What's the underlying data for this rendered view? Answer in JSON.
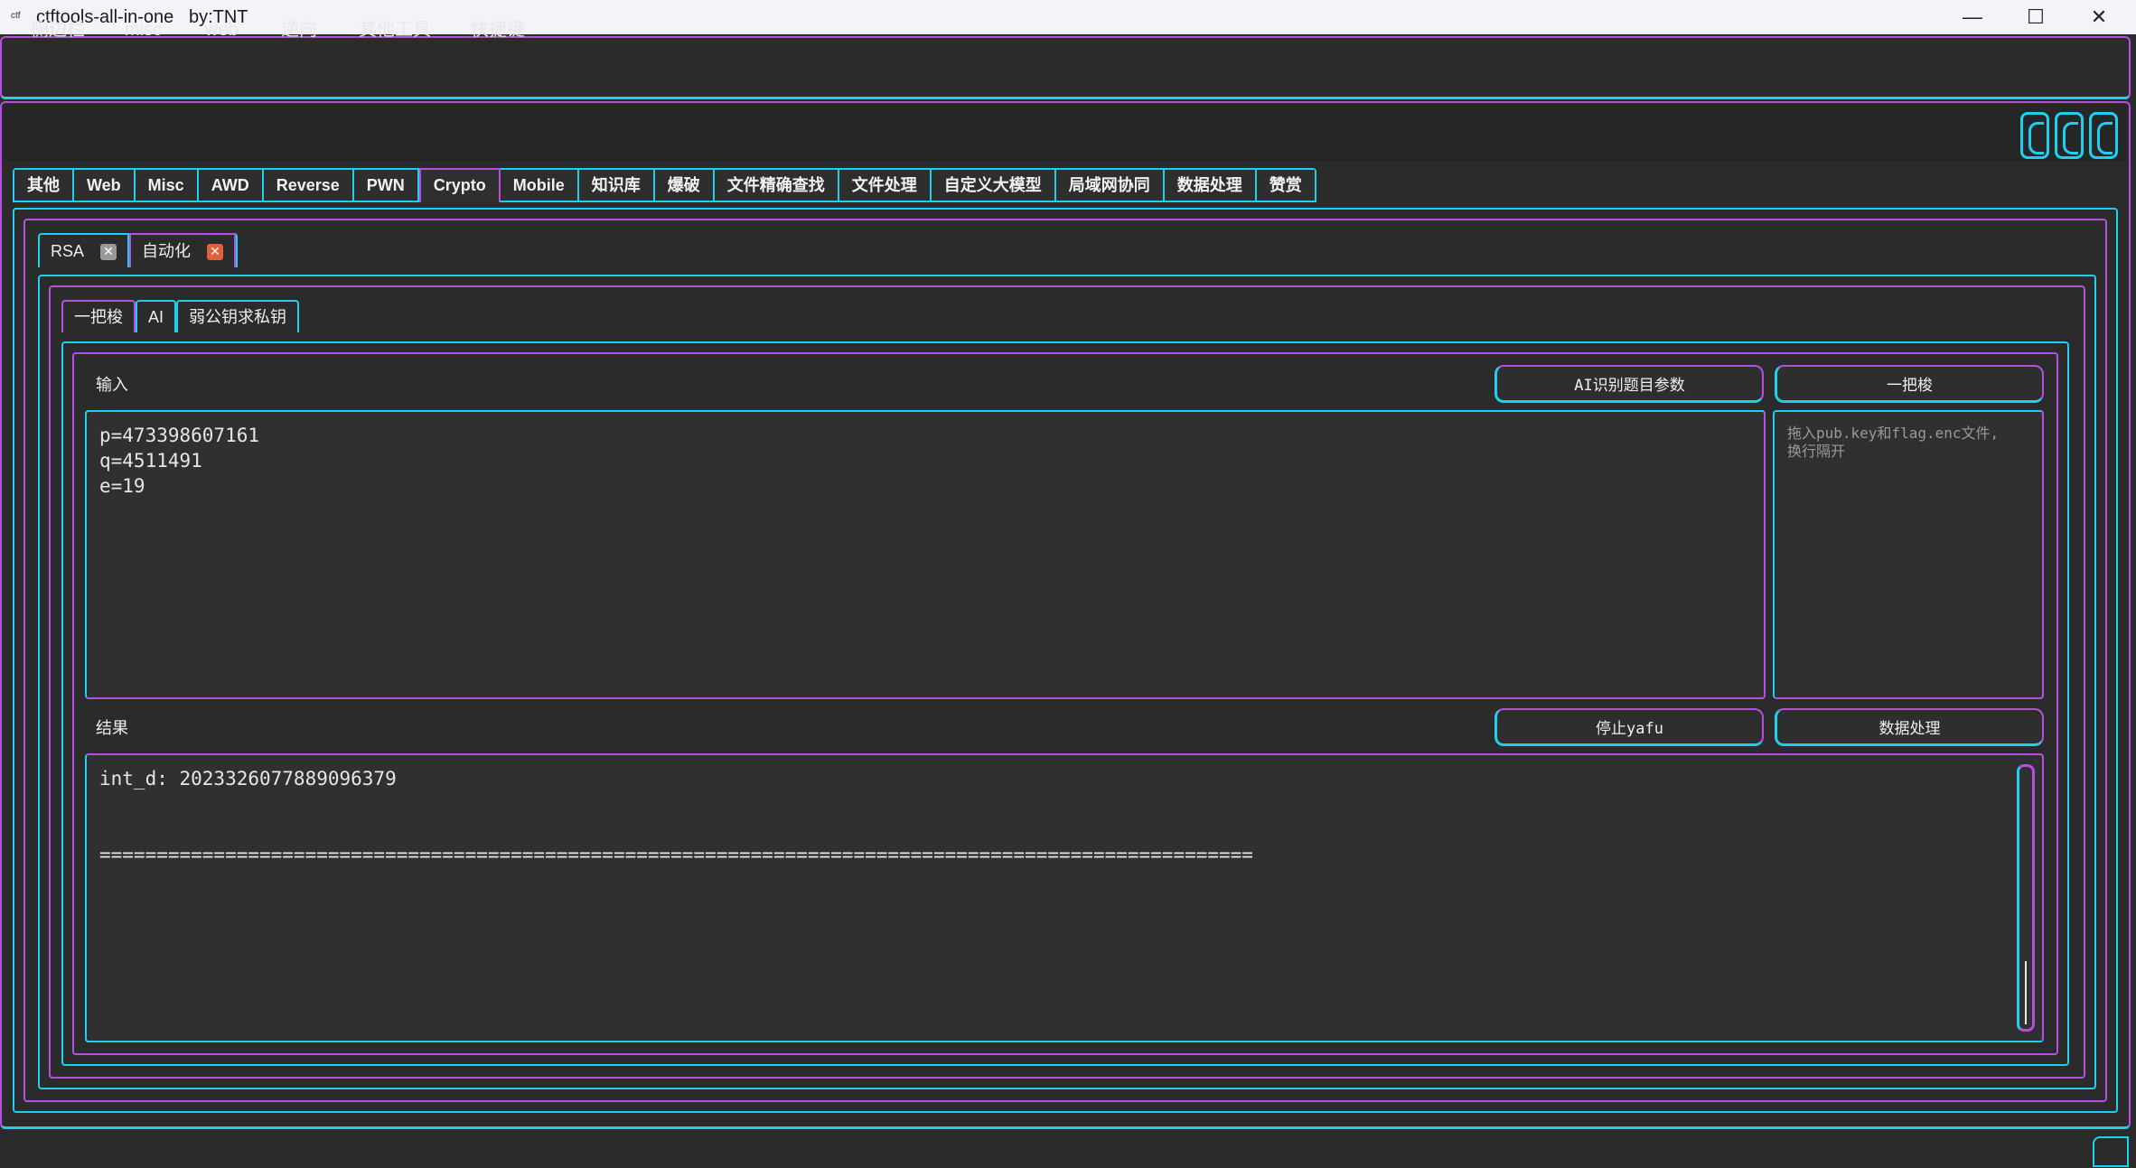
{
  "window": {
    "app_icon_text": "ctf",
    "title": "ctftools-all-in-one   by:TNT",
    "minimize": "—",
    "maximize": "☐",
    "close": "✕"
  },
  "menu": [
    "侧边栏",
    "misc",
    "web",
    "逆向",
    "其他工具",
    "快捷键"
  ],
  "top_tabs": [
    "其他",
    "Web",
    "Misc",
    "AWD",
    "Reverse",
    "PWN",
    "Crypto",
    "Mobile",
    "知识库",
    "爆破",
    "文件精确查找",
    "文件处理",
    "自定义大模型",
    "局域网协同",
    "数据处理",
    "赞赏"
  ],
  "active_top_tab": "Crypto",
  "sub_tabs": [
    {
      "label": "RSA",
      "close": "✕",
      "close_color": "#9a9a9a"
    },
    {
      "label": "自动化",
      "close": "✕",
      "close_color": "#e0603a"
    }
  ],
  "tool_tabs": [
    "一把梭",
    "AI",
    "弱公钥求私钥"
  ],
  "input_section": {
    "label": "输入",
    "ai_button": "AI识别题目参数",
    "run_button": "一把梭",
    "text": "p=473398607161\nq=4511491\ne=19",
    "drop_placeholder": "拖入pub.key和flag.enc文件,\n换行隔开"
  },
  "result_section": {
    "label": "结果",
    "stop_button": "停止yafu",
    "data_button": "数据处理",
    "text": "int_d: 2023326077889096379\n\n\n====================================================================================================="
  },
  "colors": {
    "cyan": "#1ed0f0",
    "purple": "#b44fe0",
    "background": "#2b2b2b"
  }
}
